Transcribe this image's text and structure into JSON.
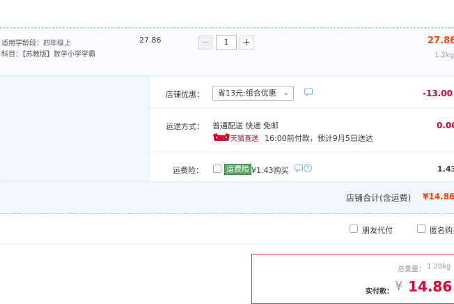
{
  "item": {
    "attr1": "适用学龄段：四年级上",
    "attr2": "科目：【苏教版】数学小学学霸",
    "unit_price": "27.86",
    "quantity": "1",
    "minus": "−",
    "plus": "+",
    "total": "27.86",
    "weight": "1.2kg"
  },
  "shop": {
    "discount_label": "店铺优惠：",
    "discount_select": "省13元:组合优惠",
    "discount_amount": "-13.00",
    "shipping_label": "运送方式：",
    "shipping_method": "普通配送 快递 免邮",
    "tmall_badge": "天猫直送",
    "shipping_note": "16:00前付款，预计9月5日送达",
    "shipping_amount": "0.00",
    "insurance_label": "运费险：",
    "insurance_tag": "运费险",
    "insurance_text": "¥1.43购买",
    "insurance_amount": "1.43",
    "subtotal_label": "店铺合计(含运费)",
    "subtotal_value": "¥14.86"
  },
  "options": {
    "friend_pay": "朋友代付",
    "anonymous": "匿名购买"
  },
  "pay": {
    "weight_label": "总重量：",
    "weight_value": "1.20kg",
    "actual_label": "实付款：",
    "currency": "¥",
    "actual_value": "14.86"
  },
  "colors": {
    "accent_red": "#e4002b",
    "orange": "#f40",
    "light_blue_bg": "#f2f7ff",
    "tag_green": "#56a864"
  }
}
